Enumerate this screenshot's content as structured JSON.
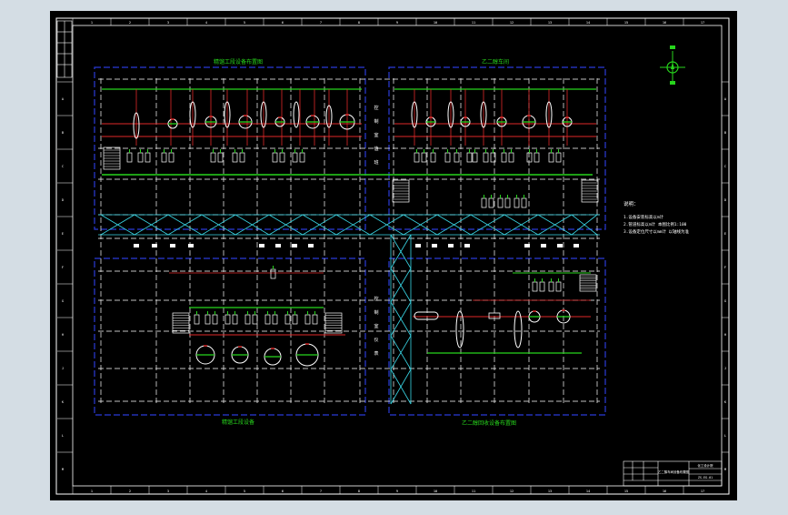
{
  "drawing": {
    "colors": {
      "viewport_bg": "#d4dde4",
      "sheet_bg": "#000000",
      "frame": "#ffffff",
      "zone_border": "#2b3bd8",
      "grid": "#ffffff",
      "pipe_green": "#27d51c",
      "pipe_red": "#e02828",
      "cross_cyan": "#39d7e6",
      "text_green": "#27d51c"
    },
    "ruler_top": [
      "1",
      "2",
      "3",
      "4",
      "5",
      "6",
      "7",
      "8",
      "9",
      "10",
      "11",
      "12",
      "13",
      "14",
      "15",
      "16",
      "17"
    ],
    "ruler_side": [
      "A",
      "B",
      "C",
      "D",
      "E",
      "F",
      "G",
      "H",
      "J",
      "K",
      "L",
      "M"
    ],
    "zone_titles": {
      "top_left": "精馏工段设备布置图",
      "top_right": "乙二醇车间",
      "bottom_left": "精馏工段设备",
      "bottom_right": "乙二醇回收设备布置图"
    },
    "room_labels_left": [
      "控",
      "制",
      "室",
      "值",
      "班"
    ],
    "room_labels_bottom": [
      "控",
      "制",
      "室",
      "仪",
      "表"
    ],
    "notes": {
      "heading": "说明：",
      "lines": [
        "1.设备安装标高以m计",
        "2.管道标高以m计 本图比例1:100",
        "3.设备定位尺寸以mm计 以轴线为准"
      ]
    },
    "title_block": {
      "drawing_name": "乙二醇车间设备布置图",
      "company": "化工设计院",
      "drawing_no": "ZS-EG-01"
    }
  }
}
